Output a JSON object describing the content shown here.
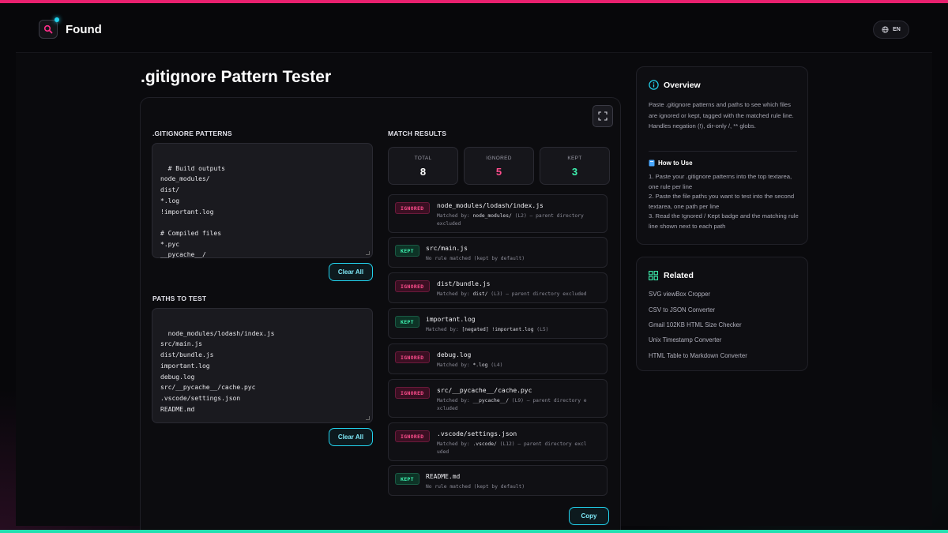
{
  "app": {
    "brand": "Found",
    "lang": "EN"
  },
  "page_title": ".gitignore Pattern Tester",
  "patterns": {
    "label": ".GITIGNORE PATTERNS",
    "text": "# Build outputs\nnode_modules/\ndist/\n*.log\n!important.log\n\n# Compiled files\n*.pyc\n__pycache__/",
    "clear_label": "Clear All"
  },
  "paths": {
    "label": "PATHS TO TEST",
    "text": "node_modules/lodash/index.js\nsrc/main.js\ndist/bundle.js\nimportant.log\ndebug.log\nsrc/__pycache__/cache.pyc\n.vscode/settings.json\nREADME.md",
    "clear_label": "Clear All"
  },
  "results": {
    "label": "MATCH RESULTS",
    "stats": [
      {
        "label": "TOTAL",
        "value": "8",
        "color": "#ffffff"
      },
      {
        "label": "IGNORED",
        "value": "5",
        "color": "#ff4d8d"
      },
      {
        "label": "KEPT",
        "value": "3",
        "color": "#3ef2b0"
      }
    ],
    "items": [
      {
        "status": "IGNORED",
        "path": "node_modules/lodash/index.js",
        "prefix": "Matched by: ",
        "rule": "node_modules/",
        "suffix": " (L2) — parent directory",
        "line2": "excluded"
      },
      {
        "status": "KEPT",
        "path": "src/main.js",
        "prefix": "No rule matched (kept by default)",
        "rule": "",
        "suffix": "",
        "line2": ""
      },
      {
        "status": "IGNORED",
        "path": "dist/bundle.js",
        "prefix": "Matched by: ",
        "rule": "dist/",
        "suffix": " (L3) — parent directory excluded",
        "line2": ""
      },
      {
        "status": "KEPT",
        "path": "important.log",
        "prefix": "Matched by: ",
        "rule": "[negated] !important.log",
        "suffix": " (L5)",
        "line2": ""
      },
      {
        "status": "IGNORED",
        "path": "debug.log",
        "prefix": "Matched by: ",
        "rule": "*.log",
        "suffix": " (L4)",
        "line2": ""
      },
      {
        "status": "IGNORED",
        "path": "src/__pycache__/cache.pyc",
        "prefix": "Matched by: ",
        "rule": "__pycache__/",
        "suffix": " (L9) — parent directory e",
        "line2": "xcluded"
      },
      {
        "status": "IGNORED",
        "path": ".vscode/settings.json",
        "prefix": "Matched by: ",
        "rule": ".vscode/",
        "suffix": " (L12) — parent directory excl",
        "line2": "uded"
      },
      {
        "status": "KEPT",
        "path": "README.md",
        "prefix": "No rule matched (kept by default)",
        "rule": "",
        "suffix": "",
        "line2": ""
      }
    ],
    "copy_label": "Copy"
  },
  "overview": {
    "title": "Overview",
    "text": "Paste .gitignore patterns and paths to see which files are ignored or kept, tagged with the matched rule line. Handles negation (!), dir-only /, ** globs.",
    "how_title": "How to Use",
    "steps": [
      "1. Paste your .gitignore patterns into the top textarea, one rule per line",
      "2. Paste the file paths you want to test into the second textarea, one path per line",
      "3. Read the Ignored / Kept badge and the matching rule line shown next to each path"
    ]
  },
  "related": {
    "title": "Related",
    "links": [
      "SVG viewBox Cropper",
      "CSV to JSON Converter",
      "Gmail 102KB HTML Size Checker",
      "Unix Timestamp Converter",
      "HTML Table to Markdown Converter"
    ]
  },
  "colors": {
    "accent_pink": "#e8206f",
    "accent_cyan": "#22d3ee",
    "accent_green": "#22e0b0"
  },
  "icons": {
    "logo": "search-icon",
    "lang": "globe-icon",
    "fullscreen": "expand-icon",
    "overview": "info-icon",
    "how": "book-icon",
    "related": "grid-icon"
  }
}
